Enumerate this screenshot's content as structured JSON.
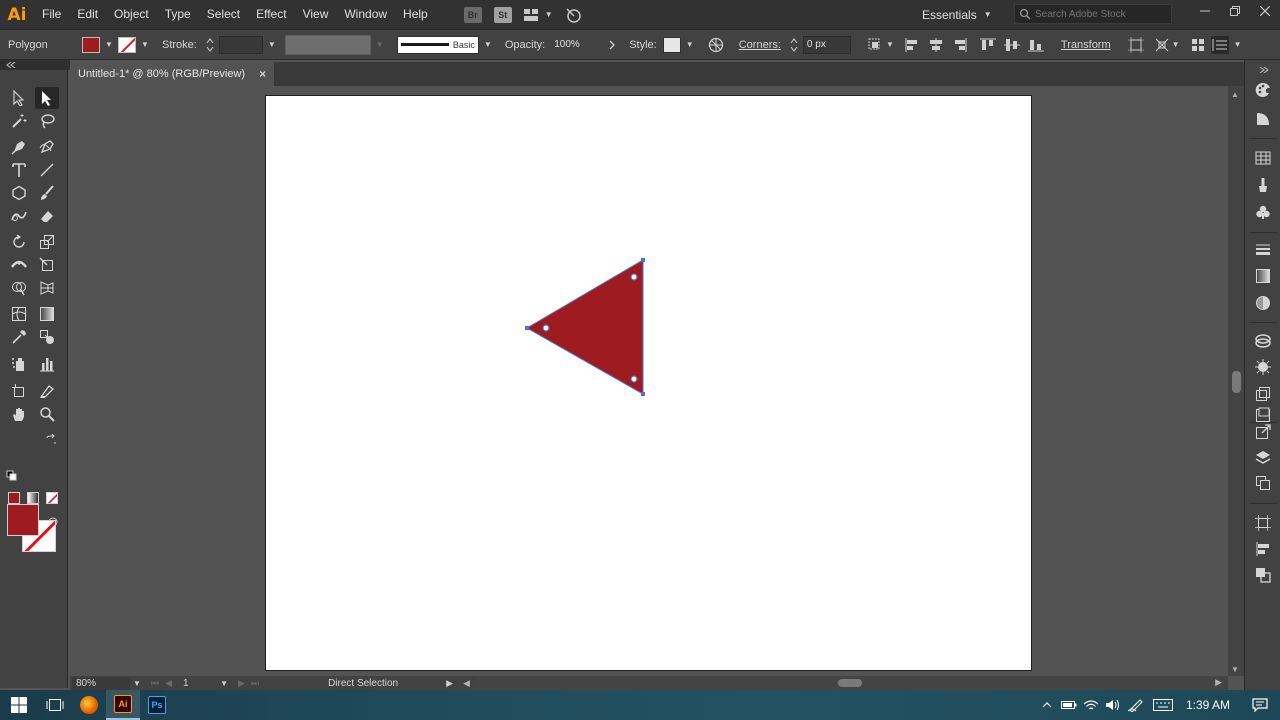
{
  "app": {
    "logo": "Ai",
    "menu": [
      "File",
      "Edit",
      "Object",
      "Type",
      "Select",
      "Effect",
      "View",
      "Window",
      "Help"
    ],
    "bridge_label": "Br",
    "stock_label": "St",
    "workspace": "Essentials",
    "search_placeholder": "Search Adobe Stock"
  },
  "control_bar": {
    "object_type": "Polygon",
    "stroke_label": "Stroke:",
    "stroke_style": "Basic",
    "opacity_label": "Opacity:",
    "opacity_value": "100%",
    "style_label": "Style:",
    "corners_label": "Corners:",
    "corners_value": "0 px",
    "transform_label": "Transform"
  },
  "document": {
    "tab_title": "Untitled-1* @ 80% (RGB/Preview)",
    "close_symbol": "×"
  },
  "status_bar": {
    "zoom": "80%",
    "artboard_number": "1",
    "status_text": "Direct Selection"
  },
  "taskbar": {
    "illustrator_label": "Ai",
    "photoshop_label": "Ps",
    "time": "1:39 AM"
  },
  "colors": {
    "fill": "#9e1b1f",
    "accent_logo": "#ff9a00",
    "selection": "#4f6fd6"
  },
  "icons": {
    "toolbar": [
      "selection-icon",
      "direct-selection-icon",
      "magic-wand-icon",
      "lasso-icon",
      "pen-icon",
      "curvature-icon",
      "type-icon",
      "line-segment-icon",
      "polygon-icon",
      "paintbrush-icon",
      "shaper-icon",
      "eraser-icon",
      "rotate-icon",
      "scale-icon",
      "width-icon",
      "free-transform-icon",
      "shape-builder-icon",
      "perspective-grid-icon",
      "mesh-icon",
      "gradient-icon",
      "eyedropper-icon",
      "blend-icon",
      "symbol-sprayer-icon",
      "column-graph-icon",
      "artboard-icon",
      "slice-icon",
      "hand-icon",
      "zoom-icon"
    ]
  }
}
